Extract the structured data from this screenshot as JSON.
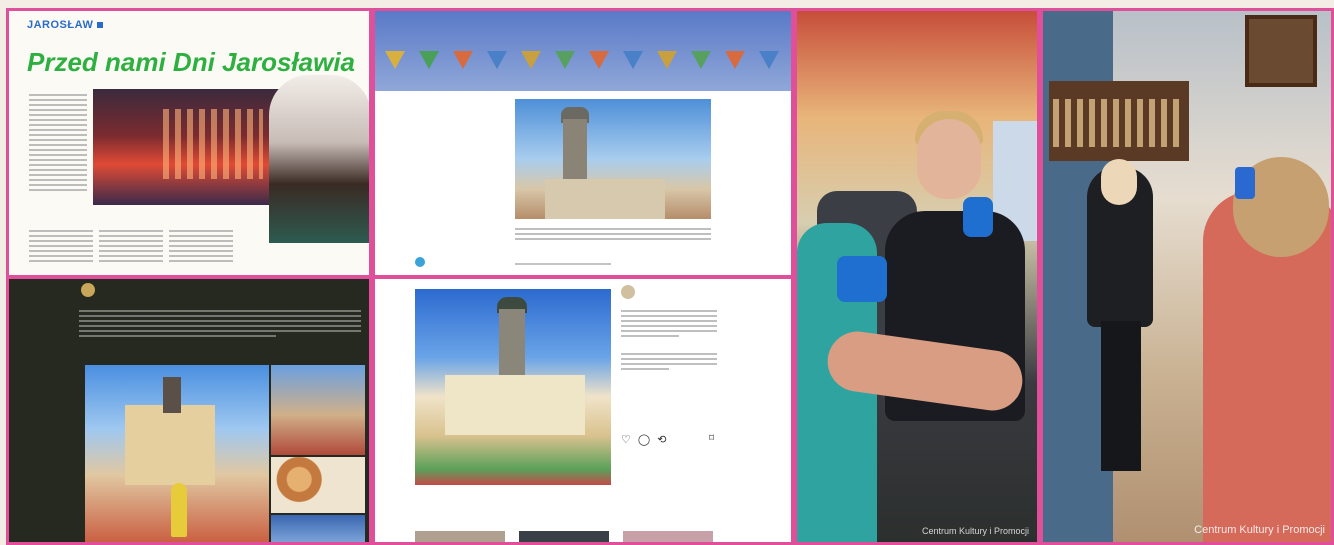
{
  "newspaper": {
    "section": "JAROSŁAW",
    "title": "Przed nami Dni Jarosławia"
  },
  "captions": {
    "panel5": "Centrum Kultury i Promocji",
    "panel6": "Centrum Kultury i Promocji"
  },
  "colors": {
    "border": "#e0509a",
    "headline": "#2db040",
    "section": "#2a6cc9"
  },
  "icons": {
    "instagram_actions": "♡ ◯ ⟲",
    "instagram_save": "⌑"
  }
}
